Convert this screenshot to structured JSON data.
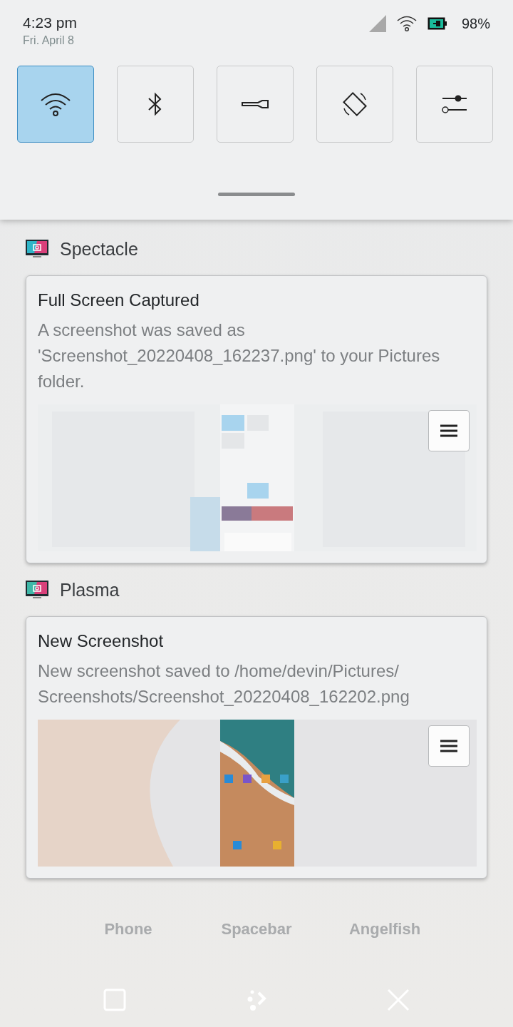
{
  "status_bar": {
    "time": "4:23 pm",
    "date": "Fri. April 8",
    "battery": "98%"
  },
  "quick_settings": [
    {
      "kind": "wifi",
      "selected": true
    },
    {
      "kind": "bluetooth",
      "selected": false
    },
    {
      "kind": "flashlight",
      "selected": false
    },
    {
      "kind": "rotation",
      "selected": false
    },
    {
      "kind": "settings",
      "selected": false
    }
  ],
  "background": {
    "apps": [
      "Phone",
      "Spacebar",
      "Angelfish"
    ]
  },
  "notifications": [
    {
      "app": "Spectacle",
      "title": "Full Screen Captured",
      "body": "A screenshot was saved as 'Screenshot_20220408_162237.png' to your Pictures folder."
    },
    {
      "app": "Plasma",
      "title": "New Screenshot",
      "body": "New screenshot saved to /home/devin/Pictures/ Screenshots/Screenshot_20220408_162202.png"
    }
  ]
}
